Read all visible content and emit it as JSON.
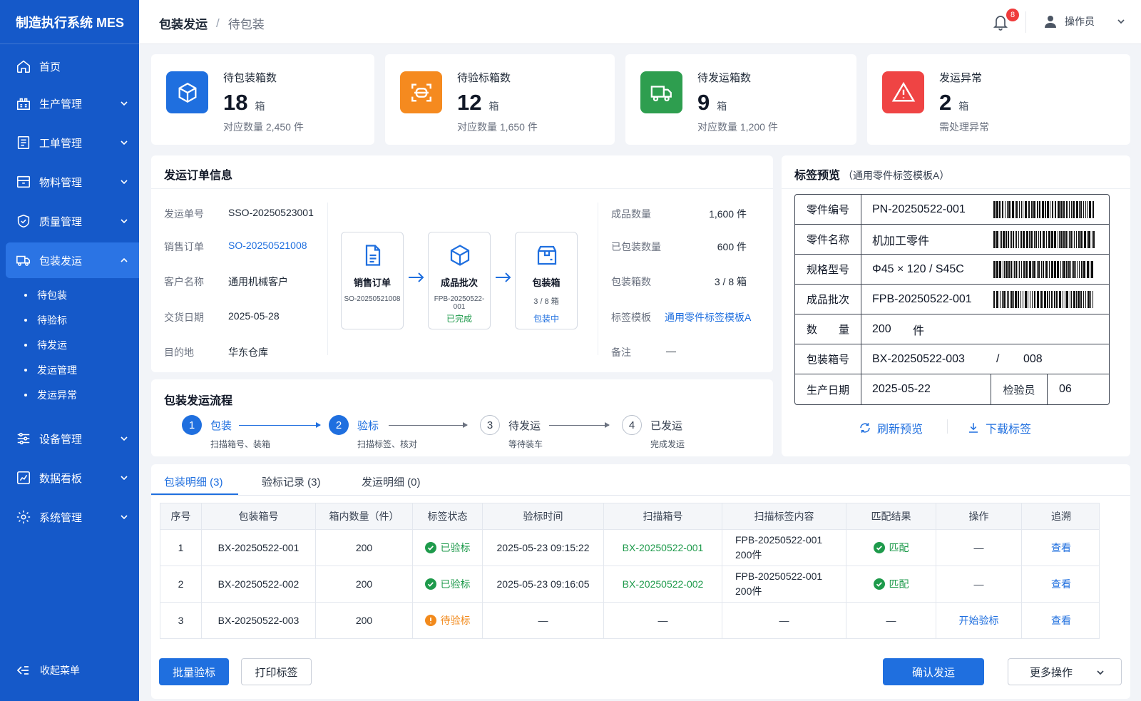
{
  "app": {
    "title": "制造执行系统 MES"
  },
  "nav": {
    "home": "首页",
    "production": "生产管理",
    "workorder": "工单管理",
    "material": "物料管理",
    "quality": "质量管理",
    "packaging": "包装发运",
    "sub": [
      "待包装",
      "待验标",
      "待发运",
      "发运管理",
      "发运异常"
    ],
    "equipment": "设备管理",
    "dashboard": "数据看板",
    "system": "系统管理",
    "collapse": "收起菜单"
  },
  "header": {
    "crumb1": "包装发运",
    "crumb_sep": "/",
    "crumb2": "待包装",
    "notifications": "8",
    "user": "操作员"
  },
  "stats": [
    {
      "label": "待包装箱数",
      "value": "18",
      "unit": "箱",
      "sub": "对应数量  2,450 件",
      "color": "#1f6fdf",
      "icon": "box-icon"
    },
    {
      "label": "待验标箱数",
      "value": "12",
      "unit": "箱",
      "sub": "对应数量  1,650 件",
      "color": "#f58a1f",
      "icon": "scan-icon"
    },
    {
      "label": "待发运箱数",
      "value": "9",
      "unit": "箱",
      "sub": "对应数量  1,200 件",
      "color": "#2e9e4f",
      "icon": "truck-icon"
    },
    {
      "label": "发运异常",
      "value": "2",
      "unit": "箱",
      "sub": "需处理异常",
      "color": "#ef4444",
      "icon": "warning-icon"
    }
  ],
  "order": {
    "title": "发运订单信息",
    "left": [
      {
        "k": "发运单号",
        "v": "SSO-20250523001"
      },
      {
        "k": "销售订单",
        "v": "SO-20250521008"
      },
      {
        "k": "客户名称",
        "v": "通用机械客户"
      },
      {
        "k": "交货日期",
        "v": "2025-05-28"
      },
      {
        "k": "目的地",
        "v": "华东仓库"
      }
    ],
    "flow": [
      {
        "title": "销售订单",
        "sub": "SO-20250521008",
        "status": ""
      },
      {
        "title": "成品批次",
        "sub": "FPB-20250522-001",
        "status": "已完成"
      },
      {
        "title": "包装箱",
        "sub": "3 / 8 箱",
        "status": "包装中"
      }
    ],
    "right": [
      {
        "k": "成品数量",
        "v": "1,600 件"
      },
      {
        "k": "已包装数量",
        "v": "600 件"
      },
      {
        "k": "包装箱数",
        "v": "3 / 8 箱"
      },
      {
        "k": "标签模板",
        "v": "通用零件标签模板A"
      },
      {
        "k": "备注",
        "v": "—"
      }
    ]
  },
  "process": {
    "title": "包装发运流程",
    "steps": [
      {
        "num": "1",
        "name": "包装",
        "desc": "扫描箱号、装箱"
      },
      {
        "num": "2",
        "name": "验标",
        "desc": "扫描标签、核对"
      },
      {
        "num": "3",
        "name": "待发运",
        "desc": "等待装车"
      },
      {
        "num": "4",
        "name": "已发运",
        "desc": "完成发运"
      }
    ]
  },
  "label": {
    "title": "标签预览",
    "template": "（通用零件标签模板A）",
    "rows": [
      {
        "k": "零件编号",
        "v": "PN-20250522-001"
      },
      {
        "k": "零件名称",
        "v": "机加工零件"
      },
      {
        "k": "规格型号",
        "v": "Φ45 × 120 / S45C"
      },
      {
        "k": "成品批次",
        "v": "FPB-20250522-001"
      },
      {
        "k": "数　　量",
        "v": "200",
        "v2": "件"
      },
      {
        "k": "包装箱号",
        "v": "BX-20250522-003",
        "v2": "/",
        "v3": "008"
      },
      {
        "k": "生产日期",
        "v": "2025-05-22",
        "k2": "检验员",
        "v2": "06"
      }
    ],
    "refresh": "刷新预览",
    "download": "下载标签"
  },
  "tabs": [
    "包装明细 (3)",
    "验标记录 (3)",
    "发运明细 (0)"
  ],
  "table": {
    "headers": [
      "序号",
      "包装箱号",
      "箱内数量（件）",
      "标签状态",
      "验标时间",
      "扫描箱号",
      "扫描标签内容",
      "匹配结果",
      "操作",
      "追溯"
    ],
    "rows": [
      {
        "no": "1",
        "box": "BX-20250522-001",
        "qty": "200",
        "status": "已验标",
        "time": "2025-05-23 09:15:22",
        "scan": "BX-20250522-001",
        "content1": "FPB-20250522-001",
        "content2": "200件",
        "match": "匹配",
        "op": "—",
        "trace": "查看"
      },
      {
        "no": "2",
        "box": "BX-20250522-002",
        "qty": "200",
        "status": "已验标",
        "time": "2025-05-23 09:16:05",
        "scan": "BX-20250522-002",
        "content1": "FPB-20250522-001",
        "content2": "200件",
        "match": "匹配",
        "op": "—",
        "trace": "查看"
      },
      {
        "no": "3",
        "box": "BX-20250522-003",
        "qty": "200",
        "status": "待验标",
        "time": "—",
        "scan": "—",
        "content1": "—",
        "content2": "",
        "match": "—",
        "op": "开始验标",
        "trace": "查看"
      }
    ]
  },
  "actions": {
    "batch": "批量验标",
    "print": "打印标签",
    "confirm": "确认发运",
    "more": "更多操作"
  }
}
